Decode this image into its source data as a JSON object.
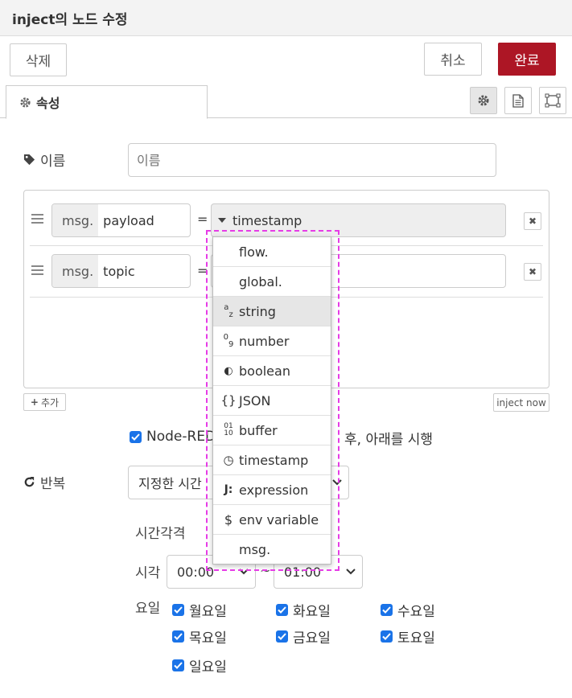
{
  "dialog": {
    "title": "inject의 노드 수정"
  },
  "toolbar": {
    "delete_label": "삭제",
    "cancel_label": "취소",
    "done_label": "완료"
  },
  "tabs": {
    "properties_label": "속성"
  },
  "form": {
    "name_label": "이름",
    "name_placeholder": "이름",
    "props": [
      {
        "prefix": "msg.",
        "key": "payload",
        "eq": "=",
        "type": "timestamp"
      },
      {
        "prefix": "msg.",
        "key": "topic",
        "eq": "="
      }
    ],
    "add_label": "추가",
    "inject_now_label": "inject now",
    "once_prefix": "Node-RED",
    "once_suffix": "후, 아래를 시행",
    "repeat_label": "반복",
    "repeat_value": "지정한 시간",
    "interval_label": "시간각격",
    "time_label": "시각",
    "time_from": "00:00",
    "time_sep": "~",
    "time_to": "01:00",
    "days_label": "요일",
    "days": [
      "월요일",
      "화요일",
      "수요일",
      "목요일",
      "금요일",
      "토요일",
      "일요일"
    ]
  },
  "type_menu": {
    "items": [
      {
        "icon": "",
        "label": "flow."
      },
      {
        "icon": "",
        "label": "global."
      },
      {
        "icon": "az",
        "label": "string"
      },
      {
        "icon": "09",
        "label": "number"
      },
      {
        "icon": "◐",
        "label": "boolean"
      },
      {
        "icon": "{}",
        "label": "JSON"
      },
      {
        "icon": "01/10",
        "label": "buffer"
      },
      {
        "icon": "◷",
        "label": "timestamp"
      },
      {
        "icon": "J:",
        "label": "expression"
      },
      {
        "icon": "$",
        "label": "env variable"
      },
      {
        "icon": "",
        "label": "msg."
      }
    ],
    "highlighted": "string"
  },
  "colors": {
    "primary": "#ad1625",
    "checkbox": "#1a73e8",
    "highlight_dash": "#e63ce6"
  }
}
